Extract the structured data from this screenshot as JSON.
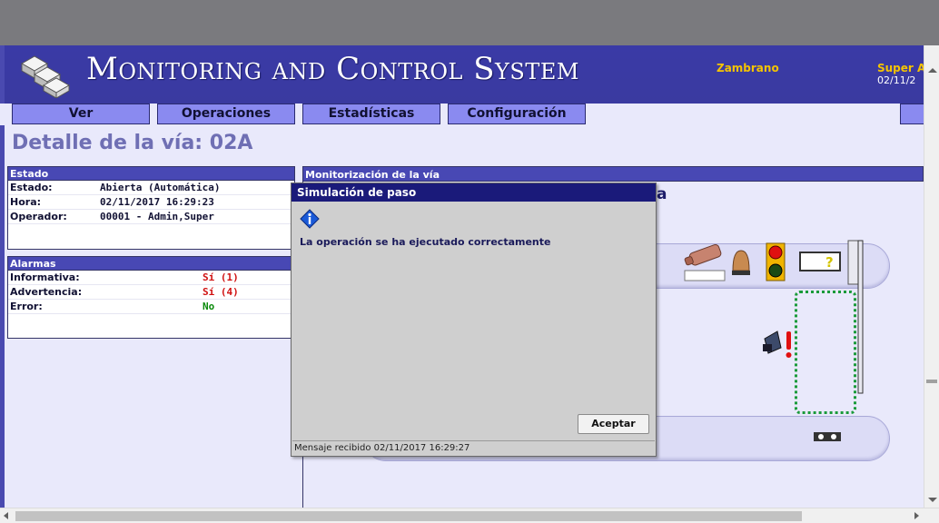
{
  "app": {
    "title": "Monitoring and Control System",
    "user_name": "Zambrano",
    "user_role": "Super A",
    "user_date": "02/11/2"
  },
  "menu": {
    "items": [
      {
        "label": "Ver"
      },
      {
        "label": "Operaciones"
      },
      {
        "label": "Estadísticas"
      },
      {
        "label": "Configuración"
      }
    ]
  },
  "page": {
    "title": "Detalle de la vía: 02A"
  },
  "estado_panel": {
    "header": "Estado",
    "rows": [
      {
        "label": "Estado:",
        "value": "Abierta (Automática)"
      },
      {
        "label": "Hora:",
        "value": "02/11/2017 16:29:23"
      },
      {
        "label": "Operador:",
        "value": "00001 - Admin,Super"
      }
    ]
  },
  "alarmas_panel": {
    "header": "Alarmas",
    "rows": [
      {
        "label": "Informativa:",
        "value": "Sí (1)",
        "status_color": "#d01010"
      },
      {
        "label": "Advertencia:",
        "value": "Sí (4)",
        "status_color": "#d01010"
      },
      {
        "label": "Error:",
        "value": "No",
        "status_color": "#0a8a0a"
      }
    ]
  },
  "monitor": {
    "header": "Monitorización de la vía",
    "lane_letter_partial": "a",
    "devices": [
      "camera-icon",
      "dome-icon",
      "traffic-light-icon",
      "display-sign-icon",
      "barrier-icon",
      "detector-icon",
      "warning-icon"
    ]
  },
  "dialog": {
    "title": "Simulación de paso",
    "icon": "info-icon",
    "message": "La operación se ha ejecutado correctamente",
    "accept_label": "Aceptar",
    "status": "Mensaje recibido 02/11/2017 16:29:27"
  },
  "colors": {
    "banner": "#3a3aa6",
    "menu": "#8a8af0",
    "panel_header": "#4848b4",
    "dialog_title": "#1a1a7a",
    "user_name": "#f5c400"
  }
}
